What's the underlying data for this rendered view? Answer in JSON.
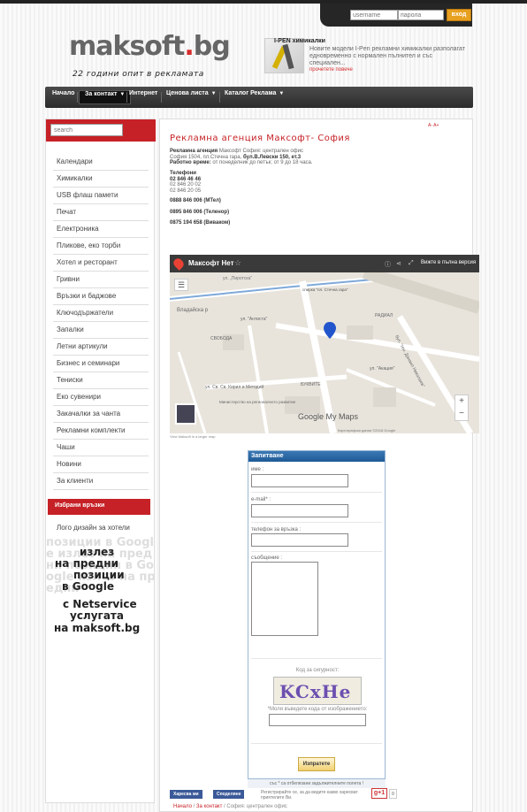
{
  "login": {
    "username_placeholder": "username",
    "password_placeholder": "парола",
    "submit_label": "вход"
  },
  "brand": {
    "name": "maksoft",
    "dot": ".",
    "tld": "bg",
    "tagline": "22 години опит в рекламата"
  },
  "news": {
    "title": "I-PEN химикалки",
    "body": "Новите модели I-Pen рекламни химикалки разполагат едновременно с нормален пълнител и със специален...",
    "more": "прочетете повече"
  },
  "nav": {
    "items": [
      "Начало",
      "За контакт",
      "Интернет",
      "Ценова листа",
      "Каталог Реклама"
    ]
  },
  "sidebar": {
    "search_placeholder": "search",
    "menu": [
      "Календари",
      "Химикалки",
      "USB флаш памети",
      "Печат",
      "Електроника",
      "Пликове, еко торби",
      "Хотел и ресторант",
      "Гривни",
      "Връзки и баджове",
      "Ключодържатели",
      "Запалки",
      "Летни артикули",
      "Бизнес и семинари",
      "Тениски",
      "Еко сувенири",
      "Закачалки за чанта",
      "Рекламни комплекти",
      "Чаши",
      "Новини",
      "За клиенти"
    ],
    "favorites_title": "Избрани връзки",
    "favorites_link": "Лого дизайн за хотели",
    "promo": {
      "line1": "излез",
      "line2": "на предни",
      "line3": "позиции",
      "line4": "в Google",
      "line5": "с Netservice",
      "line6": "услугата",
      "line7": "на maksoft.bg",
      "bg_text": "позиции в Google излез на предни позиции в Google излез на предни"
    }
  },
  "content": {
    "lang": "A- A+",
    "title": "Рекламна агенция Максофт- София",
    "info": {
      "label1": "Рекламна агенция",
      "text1": " Максофт София: централен офис",
      "text2": "София 1504, пл.Стечна гара, ",
      "addr": "бул.В.Левски 150, ет.3",
      "label3": "Работно време:",
      "text3": " от понеделник до петък; от 9 до 18 часа."
    },
    "phones_label": "Телефони",
    "phones": [
      "02 846 46 46",
      "02 846 20 02",
      "02 846 20 05"
    ],
    "mobiles": [
      "0888 846 006 (МТел)",
      "0895 846 006 (Теленор)",
      "0875 194 658 (Виваком)"
    ],
    "map": {
      "title": "Максофт Нет",
      "share": "Вижте в пълна версия",
      "brand": "Google My Maps",
      "footer": "Картографски данни ©2018 Google",
      "source": "View Maksoft in a larger map",
      "labels": [
        "Владайска р",
        "ул. „Пиротска“",
        "спирка \"пл. Стечна гара\"",
        "РАДИАЛ",
        "ул. \"Антиста\"",
        "СВОБОДА",
        "бул. \"ген. Данаил Николаев\"",
        "ул. Св. Св. Кирил и Методий",
        "БУКВИТЕ",
        "Министерство на регионалното развитие",
        "ул. \"Акация\""
      ]
    },
    "form": {
      "title": "Запитване",
      "name_label": "име :",
      "email_label": "e-mail* :",
      "phone_label": "телефон за връзка :",
      "message_label": "съобщение :",
      "captcha_label": "Код за сигурност:",
      "captcha_text": "KCxHe",
      "captcha_prompt": "*Моля въведете кода от изображението:",
      "submit_label": "Изпратете",
      "required_note": "със * са отбелязани задължителните полета !"
    },
    "social": {
      "fb_like": "Харесва ми",
      "fb_share": "Споделяне",
      "fb_text": "Регистрирайте се, за да видите какво харесват приятелите Ви.",
      "gplus": "g+1",
      "gplus_count": "0"
    },
    "breadcrumb": {
      "home": "Начало",
      "sep": " / ",
      "contact": "За контакт",
      "current": "София: централен офис"
    }
  }
}
